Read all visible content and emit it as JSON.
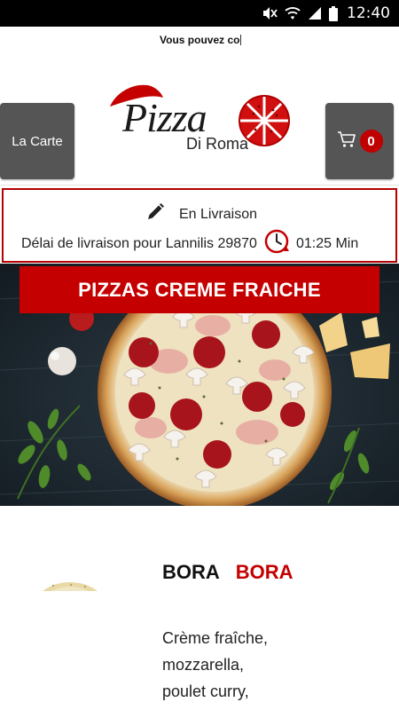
{
  "status_bar": {
    "time": "12:40",
    "icons": [
      "mute-icon",
      "wifi-icon",
      "signal-icon",
      "battery-icon"
    ]
  },
  "marquee": {
    "text": "Vous pouvez co"
  },
  "header": {
    "menu_button_label": "La Carte",
    "cart_count": "0",
    "logo": {
      "title": "Pizza",
      "subtitle": "Di Roma"
    }
  },
  "delivery": {
    "mode": "En Livraison",
    "delay_label": "Délai de livraison pour Lannilis 29870",
    "delay_time": "01:25 Min"
  },
  "category": {
    "title": "PIZZAS CREME FRAICHE"
  },
  "product": {
    "name_part1": "BORA",
    "name_part2": "BORA",
    "description_lines": [
      "Crème fraîche,",
      "mozzarella,",
      "poulet curry,"
    ]
  },
  "colors": {
    "accent": "#c40000",
    "button_bg": "#555555",
    "status_bar": "#000000"
  }
}
